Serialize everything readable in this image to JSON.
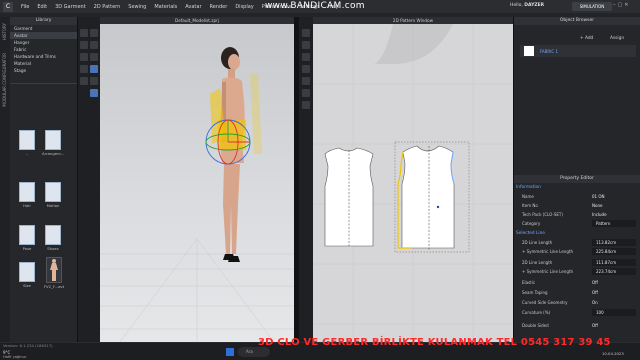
{
  "menu": {
    "logo": "C",
    "items": [
      "File",
      "Edit",
      "3D Garment",
      "2D Pattern",
      "Sewing",
      "Materials",
      "Avatar",
      "Render",
      "Display",
      "Preferences",
      "Settings",
      "Help"
    ]
  },
  "overlay": {
    "bandicam": "www.BANDICAM.com",
    "footer": "3D CLO VE GERBER BİRLİKTE KULANMAK TEL 0545 317 39 45"
  },
  "user": {
    "hello": "Hello,",
    "name": "DAYZER",
    "sim_label": "SIMULATION"
  },
  "left_tabs": {
    "history": "HISTORY",
    "config": "MODULAR CONFIGURATOR"
  },
  "library": {
    "title": "Library",
    "items": [
      "Garment",
      "Avatar",
      "Hanger",
      "Fabric",
      "Hardware and Trims",
      "Material",
      "Stage"
    ],
    "selected_index": 1,
    "thumbs": [
      {
        "label": "..",
        "dark": false
      },
      {
        "label": "Arrangem...",
        "dark": false
      },
      {
        "label": "Hair",
        "dark": false
      },
      {
        "label": "Motion",
        "dark": false
      },
      {
        "label": "Pose",
        "dark": false
      },
      {
        "label": "Shoes",
        "dark": false
      },
      {
        "label": "Size",
        "dark": false
      },
      {
        "label": "FV2_F...avt",
        "dark": true
      }
    ]
  },
  "view3d": {
    "title": "Default_Modelist.zprj"
  },
  "view2d": {
    "title": "2D Pattern Window"
  },
  "object_browser": {
    "title": "Object Browser",
    "add": "+ Add",
    "assign": "Assign",
    "fabric": "FABRIC 1"
  },
  "property_editor": {
    "title": "Property Editor",
    "information": "Information",
    "name_k": "Name",
    "name_v": "01 ON",
    "item_no_k": "Item No",
    "item_no_v": "None",
    "tech_pack_k": "Tech Pack (CLO-SET)",
    "tech_pack_v": "Include",
    "category_k": "Category",
    "category_v": "Pattern",
    "selected_line": "Selected Line",
    "line1_k": "2D Line Length",
    "line1_v": "113.82cm",
    "sym1_k": "+ Symmetric Line Length",
    "sym1_v": "225.84cm",
    "line2_k": "2D Line Length",
    "line2_v": "111.87cm",
    "sym2_k": "+ Symmetric Line Length",
    "sym2_v": "223.74cm",
    "elastic_k": "Elastic",
    "elastic_v": "Off",
    "seam_k": "Seam Taping",
    "seam_v": "Off",
    "curved_k": "Curved Side Geometry",
    "curved_v": "On",
    "curv_k": "Curvature (%)",
    "curv_v": "100",
    "double_k": "Double Sided",
    "double_v": "Off"
  },
  "status": {
    "version": "Version: 6.1.234 (186317)",
    "temp": "9°C",
    "weather": "Hafif yağmur",
    "search": "Ara",
    "date": "10.04.2023"
  },
  "colors": {
    "accent": "#6fa8ff",
    "selected_line": "#f2c500",
    "footer_red": "#ff2a2a"
  }
}
